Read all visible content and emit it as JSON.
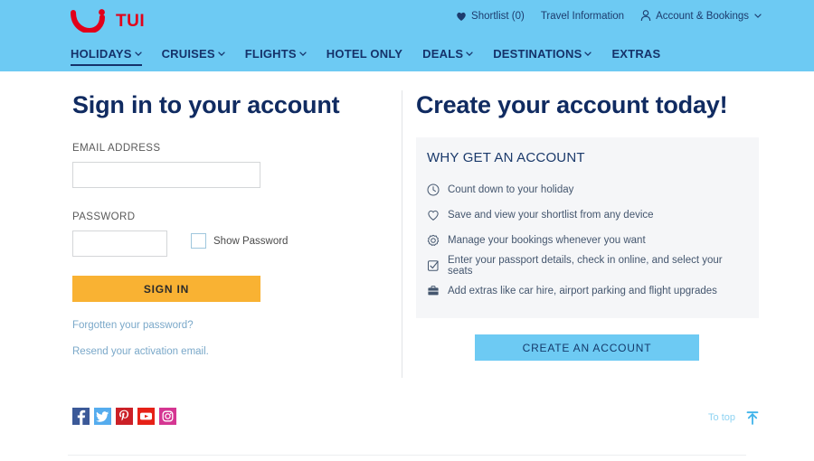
{
  "brand": {
    "name": "TUI",
    "logo_color": "#e2001a",
    "header_bg": "#6dcaf3"
  },
  "header": {
    "utility_nav": [
      {
        "label": "Shortlist (0)",
        "icon": "heart-icon"
      },
      {
        "label": "Travel Information",
        "icon": null
      },
      {
        "label": "Account & Bookings",
        "icon": "person-icon",
        "caret": true
      }
    ],
    "main_nav": [
      {
        "label": "HOLIDAYS",
        "caret": true,
        "active": true
      },
      {
        "label": "CRUISES",
        "caret": true,
        "active": false
      },
      {
        "label": "FLIGHTS",
        "caret": true,
        "active": false
      },
      {
        "label": "HOTEL ONLY",
        "caret": false,
        "active": false
      },
      {
        "label": "DEALS",
        "caret": true,
        "active": false
      },
      {
        "label": "DESTINATIONS",
        "caret": true,
        "active": false
      },
      {
        "label": "EXTRAS",
        "caret": false,
        "active": false
      }
    ]
  },
  "signin": {
    "heading": "Sign in to your account",
    "email_label": "EMAIL ADDRESS",
    "email_value": "",
    "email_placeholder": "",
    "password_label": "PASSWORD",
    "password_value": "",
    "password_placeholder": "",
    "show_password_label": "Show Password",
    "show_password_checked": false,
    "submit_label": "SIGN IN",
    "submit_color": "#f9b233",
    "forgot_link": "Forgotten your password?",
    "resend_link": "Resend your activation email."
  },
  "create": {
    "heading": "Create your account today!",
    "panel_title": "WHY GET AN ACCOUNT",
    "benefits": [
      {
        "icon": "clock-icon",
        "text": "Count down to your holiday"
      },
      {
        "icon": "heart-icon",
        "text": "Save and view your shortlist from any device"
      },
      {
        "icon": "gear-icon",
        "text": "Manage your bookings whenever you want"
      },
      {
        "icon": "checkbox-icon",
        "text": "Enter your passport details, check in online, and select your seats"
      },
      {
        "icon": "briefcase-icon",
        "text": "Add extras like car hire, airport parking and flight upgrades"
      }
    ],
    "cta_label": "CREATE AN ACCOUNT",
    "cta_color": "#6dcaf3"
  },
  "footer": {
    "social": [
      {
        "name": "facebook",
        "glyph": "f",
        "color": "#3b5998"
      },
      {
        "name": "twitter",
        "glyph": "t",
        "color": "#55acee"
      },
      {
        "name": "pinterest",
        "glyph": "p",
        "color": "#cb2027"
      },
      {
        "name": "youtube",
        "glyph": "y",
        "color": "#e62117"
      },
      {
        "name": "instagram",
        "glyph": "i",
        "color": "#d53692"
      }
    ],
    "to_top_label": "To top"
  }
}
